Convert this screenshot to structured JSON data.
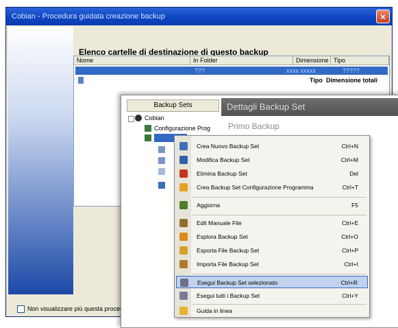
{
  "back_window": {
    "title": "Cobian - Procedura guidata creazione backup",
    "close_label": "×",
    "heading": "Elenco cartelle di destinazione di questo backup",
    "columns": [
      "Nome",
      "In Folder",
      "Dimensione",
      "Tipo"
    ],
    "selected_row": {
      "folder": "???",
      "col3": "xxxx xxxxx",
      "col4": "?????"
    },
    "row2": {
      "col_a": "Tipo",
      "col_b": "Dimensione totali"
    },
    "footer_checkbox": "Non visualizzare più questa procedura"
  },
  "front_window": {
    "tree_header": "Backup Sets",
    "tree_root": "Cobian",
    "tree_item1": "Configurazione Prog",
    "details_title": "Dettagli Backup Set",
    "details_subtitle": "Primo Backup"
  },
  "context_menu": {
    "items": [
      {
        "label": "Crea Nuovo Backup Set",
        "shortcut": "Ctrl+N",
        "icon": "new-icon",
        "color": "#3c6fb8"
      },
      {
        "label": "Modifica Backup Set",
        "shortcut": "Ctrl+M",
        "icon": "edit-icon",
        "color": "#2f5fa8"
      },
      {
        "label": "Elimina Backup Set",
        "shortcut": "Del",
        "icon": "delete-icon",
        "color": "#c8331f"
      },
      {
        "label": "Crea Backup Set Configurazione Programma",
        "shortcut": "Ctrl+T",
        "icon": "config-icon",
        "color": "#e6a11f"
      },
      {
        "label": "Aggiorna",
        "shortcut": "F5",
        "icon": "refresh-icon",
        "color": "#4d7e2a"
      },
      {
        "label": "Edit Manuale File",
        "shortcut": "Ctrl+E",
        "icon": "manual-edit-icon",
        "color": "#8f6d31"
      },
      {
        "label": "Esplora Backup Set",
        "shortcut": "Ctrl+O",
        "icon": "explore-icon",
        "color": "#d68b18"
      },
      {
        "label": "Esporta File Backup Set",
        "shortcut": "Ctrl+P",
        "icon": "export-icon",
        "color": "#d9a128"
      },
      {
        "label": "Importa File Backup Set",
        "shortcut": "Ctrl+I",
        "icon": "import-icon",
        "color": "#b07a2b"
      },
      {
        "label": "Esegui Backup Set selezionato",
        "shortcut": "Ctrl+R",
        "icon": "run-selected-icon",
        "color": "#6d6f8a"
      },
      {
        "label": "Esegui tutti i Backup Set",
        "shortcut": "Ctrl+Y",
        "icon": "run-all-icon",
        "color": "#7a7a9a"
      },
      {
        "label": "Guida in linea",
        "shortcut": "",
        "icon": "help-icon",
        "color": "#e5b32c"
      }
    ],
    "highlighted_index": 9
  }
}
